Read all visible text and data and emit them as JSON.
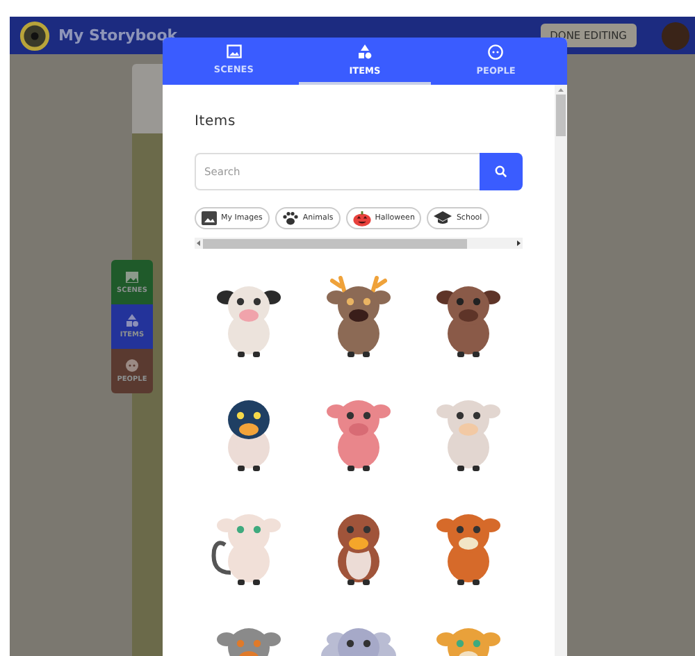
{
  "app": {
    "title": "My Storybook",
    "done_button": "DONE EDITING"
  },
  "side_tabs": [
    {
      "label": "SCENES",
      "kind": "scenes",
      "color": "#1f5a2a"
    },
    {
      "label": "ITEMS",
      "kind": "items",
      "color": "#23339a"
    },
    {
      "label": "PEOPLE",
      "kind": "people",
      "color": "#5a3a30"
    }
  ],
  "panel": {
    "tabs": [
      {
        "label": "SCENES",
        "kind": "scenes",
        "selected": false
      },
      {
        "label": "ITEMS",
        "kind": "items",
        "selected": true
      },
      {
        "label": "PEOPLE",
        "kind": "people",
        "selected": false
      }
    ],
    "heading": "Items",
    "search": {
      "placeholder": "Search"
    },
    "chips": [
      {
        "label": "My Images",
        "kind": "image"
      },
      {
        "label": "Animals",
        "kind": "paw"
      },
      {
        "label": "Halloween",
        "kind": "pumpkin"
      },
      {
        "label": "School",
        "kind": "cap"
      }
    ],
    "items": [
      {
        "kind": "cow"
      },
      {
        "kind": "reindeer"
      },
      {
        "kind": "dog"
      },
      {
        "kind": "penguin"
      },
      {
        "kind": "pig"
      },
      {
        "kind": "sheep"
      },
      {
        "kind": "cat"
      },
      {
        "kind": "hen"
      },
      {
        "kind": "fox"
      },
      {
        "kind": "owl"
      },
      {
        "kind": "elephant"
      },
      {
        "kind": "leopard"
      }
    ]
  }
}
